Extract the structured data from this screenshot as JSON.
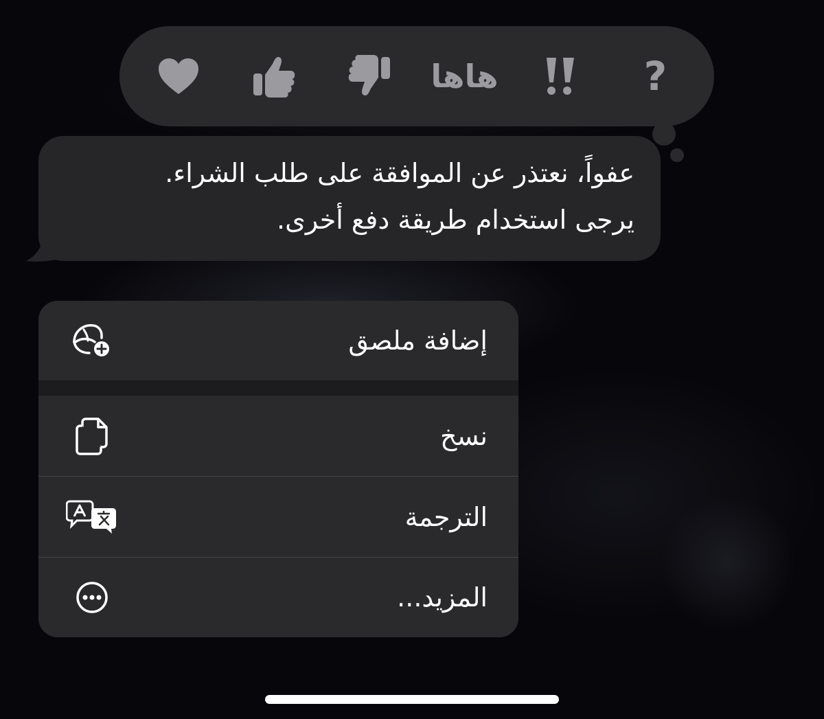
{
  "tapback": {
    "items": [
      {
        "name": "heart-icon"
      },
      {
        "name": "thumbs-up-icon"
      },
      {
        "name": "thumbs-down-icon"
      },
      {
        "name": "haha-icon",
        "label": "هاها"
      },
      {
        "name": "emphasize-icon"
      },
      {
        "name": "question-icon",
        "label": "?"
      }
    ],
    "icon_color": "#9a9a9f"
  },
  "message": {
    "lines": [
      "عفواً، نعتذر عن الموافقة على طلب الشراء.",
      "يرجى استخدام طريقة دفع أخرى."
    ]
  },
  "context_menu": {
    "items": [
      {
        "label": "إضافة ملصق",
        "icon": "add-sticker-icon"
      },
      {
        "label": "نسخ",
        "icon": "copy-icon"
      },
      {
        "label": "الترجمة",
        "icon": "translate-icon"
      },
      {
        "label": "المزيد...",
        "icon": "more-icon"
      }
    ]
  },
  "colors": {
    "background": "#07070b",
    "bubble": "#262628",
    "menu": "#2a2a2c",
    "text": "#ffffff"
  }
}
